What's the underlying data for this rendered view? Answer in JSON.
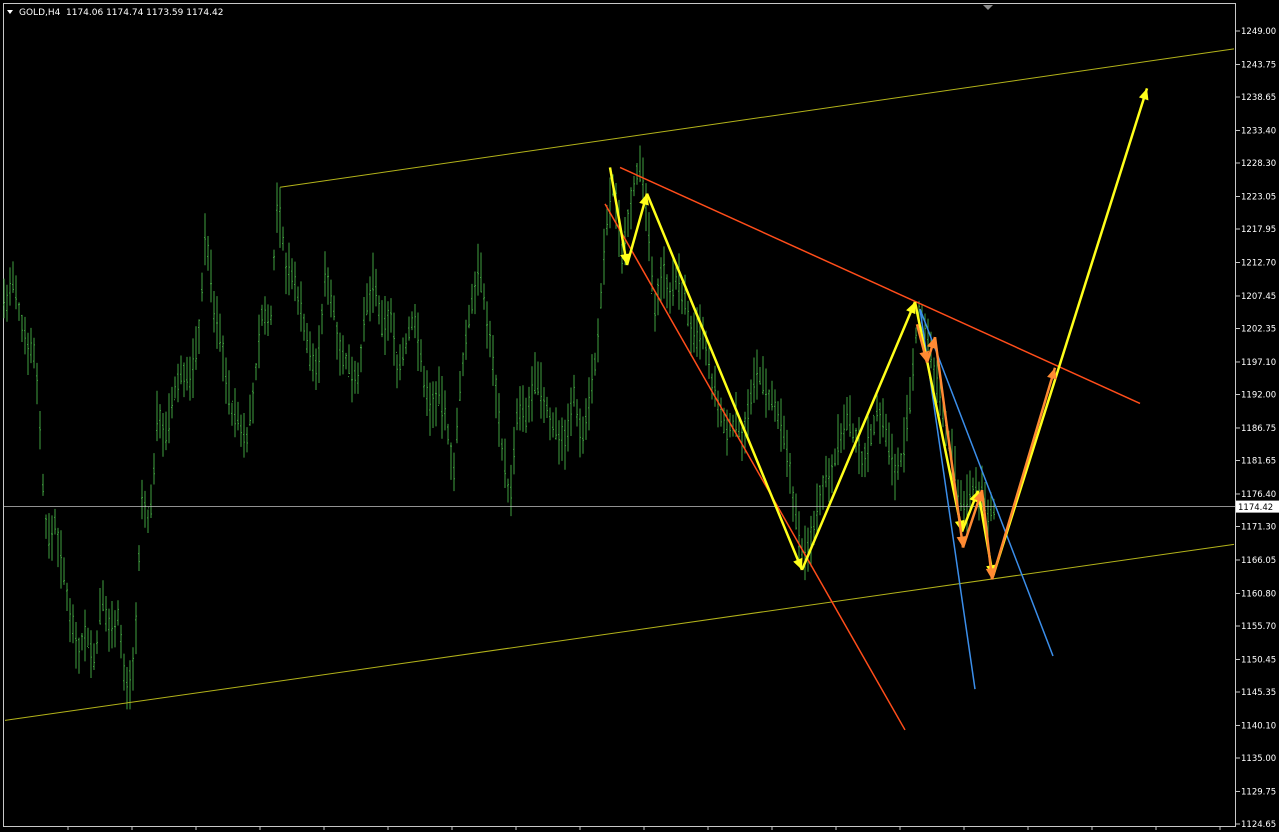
{
  "header": {
    "symbol_label": "GOLD,H4",
    "ohlc": "1174.06 1174.74 1173.59 1174.42"
  },
  "chart_data": {
    "type": "candlestick",
    "symbol": "GOLD",
    "timeframe": "H4",
    "ohlc_last": {
      "open": 1174.06,
      "high": 1174.74,
      "low": 1173.59,
      "close": 1174.42
    },
    "ylim": [
      1124.65,
      1250.0
    ],
    "y_ticks": [
      1249.0,
      1243.75,
      1238.65,
      1233.4,
      1228.3,
      1223.05,
      1217.95,
      1212.7,
      1207.45,
      1202.35,
      1197.1,
      1192.0,
      1186.75,
      1181.65,
      1176.4,
      1171.3,
      1166.05,
      1160.8,
      1155.7,
      1150.45,
      1145.35,
      1140.1,
      1135.0,
      1129.75,
      1124.65
    ],
    "current_price": 1174.42,
    "price_path": [
      [
        0,
        1216
      ],
      [
        5,
        1205
      ],
      [
        12,
        1210
      ],
      [
        20,
        1204
      ],
      [
        28,
        1200
      ],
      [
        36,
        1198
      ],
      [
        42,
        1180
      ],
      [
        48,
        1168
      ],
      [
        55,
        1172
      ],
      [
        62,
        1165
      ],
      [
        70,
        1158
      ],
      [
        78,
        1152
      ],
      [
        86,
        1155
      ],
      [
        94,
        1150
      ],
      [
        102,
        1160
      ],
      [
        110,
        1155
      ],
      [
        118,
        1158
      ],
      [
        126,
        1145
      ],
      [
        134,
        1150
      ],
      [
        142,
        1175
      ],
      [
        150,
        1172
      ],
      [
        158,
        1190
      ],
      [
        166,
        1185
      ],
      [
        174,
        1192
      ],
      [
        182,
        1196
      ],
      [
        190,
        1194
      ],
      [
        198,
        1200
      ],
      [
        206,
        1218
      ],
      [
        214,
        1205
      ],
      [
        222,
        1200
      ],
      [
        230,
        1190
      ],
      [
        238,
        1188
      ],
      [
        246,
        1185
      ],
      [
        254,
        1192
      ],
      [
        262,
        1205
      ],
      [
        270,
        1202
      ],
      [
        278,
        1225
      ],
      [
        286,
        1212
      ],
      [
        294,
        1210
      ],
      [
        302,
        1205
      ],
      [
        310,
        1198
      ],
      [
        318,
        1196
      ],
      [
        326,
        1212
      ],
      [
        334,
        1205
      ],
      [
        342,
        1198
      ],
      [
        350,
        1196
      ],
      [
        358,
        1195
      ],
      [
        366,
        1205
      ],
      [
        374,
        1210
      ],
      [
        382,
        1202
      ],
      [
        390,
        1205
      ],
      [
        398,
        1196
      ],
      [
        406,
        1200
      ],
      [
        414,
        1205
      ],
      [
        422,
        1196
      ],
      [
        430,
        1190
      ],
      [
        438,
        1192
      ],
      [
        446,
        1188
      ],
      [
        454,
        1180
      ],
      [
        462,
        1196
      ],
      [
        470,
        1205
      ],
      [
        478,
        1212
      ],
      [
        486,
        1205
      ],
      [
        494,
        1196
      ],
      [
        502,
        1184
      ],
      [
        510,
        1175
      ],
      [
        518,
        1190
      ],
      [
        526,
        1188
      ],
      [
        534,
        1194
      ],
      [
        542,
        1192
      ],
      [
        550,
        1188
      ],
      [
        558,
        1186
      ],
      [
        566,
        1185
      ],
      [
        574,
        1192
      ],
      [
        582,
        1185
      ],
      [
        590,
        1192
      ],
      [
        598,
        1200
      ],
      [
        606,
        1218
      ],
      [
        614,
        1225
      ],
      [
        622,
        1214
      ],
      [
        630,
        1222
      ],
      [
        638,
        1228
      ],
      [
        646,
        1222
      ],
      [
        654,
        1205
      ],
      [
        662,
        1212
      ],
      [
        670,
        1208
      ],
      [
        678,
        1210
      ],
      [
        686,
        1206
      ],
      [
        694,
        1200
      ],
      [
        702,
        1202
      ],
      [
        710,
        1195
      ],
      [
        718,
        1190
      ],
      [
        726,
        1186
      ],
      [
        734,
        1188
      ],
      [
        742,
        1186
      ],
      [
        750,
        1190
      ],
      [
        758,
        1196
      ],
      [
        766,
        1192
      ],
      [
        774,
        1190
      ],
      [
        782,
        1186
      ],
      [
        790,
        1180
      ],
      [
        798,
        1170
      ],
      [
        806,
        1166
      ],
      [
        814,
        1172
      ],
      [
        822,
        1178
      ],
      [
        830,
        1180
      ],
      [
        838,
        1184
      ],
      [
        846,
        1188
      ],
      [
        854,
        1186
      ],
      [
        862,
        1182
      ],
      [
        870,
        1185
      ],
      [
        878,
        1190
      ],
      [
        886,
        1186
      ],
      [
        894,
        1180
      ],
      [
        902,
        1182
      ],
      [
        910,
        1190
      ],
      [
        918,
        1205
      ],
      [
        926,
        1202
      ],
      [
        934,
        1195
      ],
      [
        942,
        1190
      ],
      [
        950,
        1184
      ],
      [
        958,
        1176
      ],
      [
        966,
        1174
      ],
      [
        974,
        1178
      ],
      [
        982,
        1176
      ],
      [
        988,
        1173
      ],
      [
        994,
        1174
      ]
    ],
    "annotations": {
      "yellow_channel": {
        "color": "#b3b31a",
        "upper": [
          [
            280,
            1224.5
          ],
          [
            1234,
            1246.2
          ]
        ],
        "upper_top": [
          [
            280,
            1224.5
          ],
          [
            280,
            1224.5
          ]
        ],
        "lower": [
          [
            5,
            1140.9
          ],
          [
            1234,
            1168.5
          ]
        ]
      },
      "red_trendline_upper": {
        "color": "#ff4d1a",
        "points": [
          [
            620,
            1227.6
          ],
          [
            1140,
            1190.6
          ]
        ]
      },
      "red_trendline_lower": {
        "color": "#ff4d1a",
        "points": [
          [
            605,
            1221.9
          ],
          [
            905,
            1139.4
          ]
        ]
      },
      "blue_lines": {
        "color": "#3b8eea",
        "lines": [
          [
            [
              920,
              1205.4
            ],
            [
              975,
              1145.8
            ]
          ],
          [
            [
              920,
              1205.4
            ],
            [
              1053,
              1151.0
            ]
          ]
        ]
      },
      "yellow_zigzag": {
        "color": "#ffff1a",
        "points": [
          [
            610,
            1227.6
          ],
          [
            627,
            1212.3
          ],
          [
            647,
            1223.5
          ],
          [
            802,
            1164.5
          ],
          [
            915,
            1206.5
          ],
          [
            962,
            1170.5
          ],
          [
            978,
            1176.9
          ],
          [
            993,
            1163.5
          ],
          [
            1147,
            1240.0
          ]
        ]
      },
      "orange_zigzag": {
        "color": "#ff8a33",
        "points": [
          [
            917,
            1203.0
          ],
          [
            927,
            1197.0
          ],
          [
            935,
            1201.0
          ],
          [
            963,
            1168.0
          ],
          [
            982,
            1177.0
          ],
          [
            992,
            1163.0
          ],
          [
            1055,
            1196.2
          ]
        ]
      }
    }
  }
}
